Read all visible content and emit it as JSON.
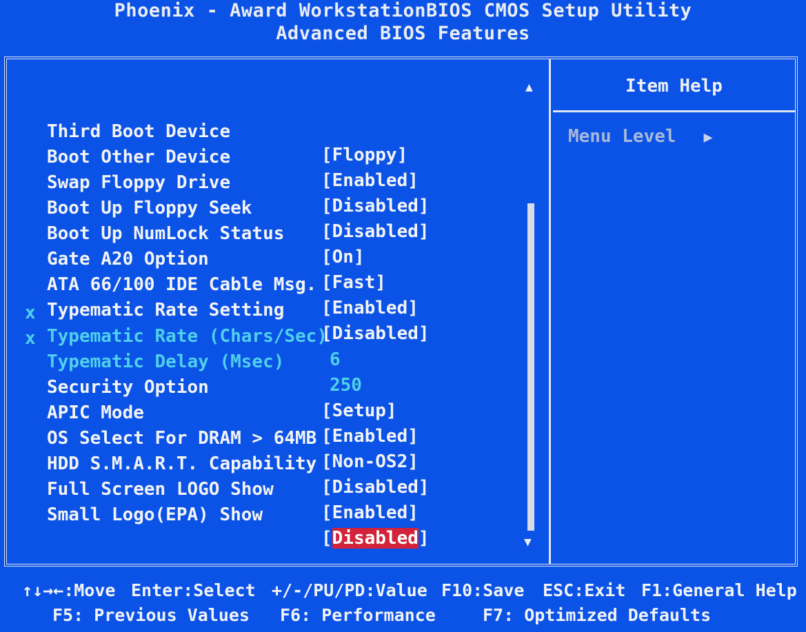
{
  "header": {
    "title": "Phoenix - Award WorkstationBIOS CMOS Setup Utility",
    "subtitle": "Advanced BIOS Features"
  },
  "settings": [
    {
      "mark": "",
      "label": "Third Boot Device",
      "value": "[Floppy]"
    },
    {
      "mark": "",
      "label": "Boot Other Device",
      "value": "[Enabled]"
    },
    {
      "mark": "",
      "label": "Swap Floppy Drive",
      "value": "[Disabled]"
    },
    {
      "mark": "",
      "label": "Boot Up Floppy Seek",
      "value": "[Disabled]"
    },
    {
      "mark": "",
      "label": "Boot Up NumLock Status",
      "value": "[On]"
    },
    {
      "mark": "",
      "label": "Gate A20 Option",
      "value": "[Fast]"
    },
    {
      "mark": "",
      "label": "ATA 66/100 IDE Cable Msg.",
      "value": "[Enabled]"
    },
    {
      "mark": "",
      "label": "Typematic Rate Setting",
      "value": "[Disabled]"
    },
    {
      "mark": "x",
      "label": "Typematic Rate (Chars/Sec)",
      "value": "6"
    },
    {
      "mark": "x",
      "label": "Typematic Delay (Msec)",
      "value": "250"
    },
    {
      "mark": "",
      "label": "Security Option",
      "value": "[Setup]"
    },
    {
      "mark": "",
      "label": "APIC Mode",
      "value": "[Enabled]"
    },
    {
      "mark": "",
      "label": "OS Select For DRAM > 64MB",
      "value": "[Non-OS2]"
    },
    {
      "mark": "",
      "label": "HDD S.M.A.R.T. Capability",
      "value": "[Disabled]"
    },
    {
      "mark": "",
      "label": "Full Screen LOGO Show",
      "value": "[Enabled]"
    },
    {
      "mark": "",
      "label": "Small Logo(EPA) Show",
      "value": "Disabled"
    }
  ],
  "selected": {
    "open_bracket": "[",
    "value": "Disabled",
    "close_bracket": "]"
  },
  "help": {
    "title": "Item Help",
    "menu_level": "Menu Level",
    "arrow": "▶"
  },
  "scrollbar": {
    "up": "▲",
    "down": "▼"
  },
  "footer": {
    "move": "↑↓→←:Move",
    "enter": "Enter:Select",
    "value": "+/-/PU/PD:Value",
    "save": "F10:Save",
    "exit": "ESC:Exit",
    "help": "F1:General Help",
    "previous": "F5: Previous Values",
    "performance": "F6: Performance",
    "optimized": "F7: Optimized Defaults"
  },
  "colors": {
    "background": "#0b52e6",
    "text": "#f2f4f8",
    "disabled_text": "#4fd0ee",
    "highlight": "#d2233a"
  }
}
